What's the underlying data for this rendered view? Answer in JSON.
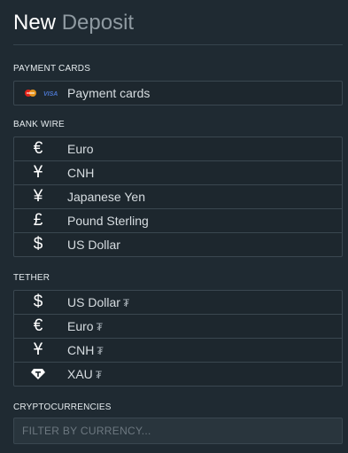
{
  "header": {
    "title_word1": "New",
    "title_word2": "Deposit"
  },
  "payment_cards": {
    "label": "PAYMENT CARDS",
    "items": [
      {
        "label": "Payment cards",
        "icon": "mastercard-visa-icon"
      }
    ]
  },
  "bank_wire": {
    "label": "BANK WIRE",
    "items": [
      {
        "icon_glyph": "€",
        "icon": "euro-icon",
        "label": "Euro"
      },
      {
        "icon_glyph": "Ұ",
        "icon": "cnh-yuan-icon",
        "label": "CNH"
      },
      {
        "icon_glyph": "¥",
        "icon": "yen-icon",
        "label": "Japanese Yen"
      },
      {
        "icon_glyph": "£",
        "icon": "pound-icon",
        "label": "Pound Sterling"
      },
      {
        "icon_glyph": "$",
        "icon": "dollar-icon",
        "label": "US Dollar"
      }
    ]
  },
  "tether": {
    "label": "TETHER",
    "items": [
      {
        "icon_glyph": "$",
        "icon": "dollar-icon",
        "label": "US Dollar",
        "suffix": "₮"
      },
      {
        "icon_glyph": "€",
        "icon": "euro-icon",
        "label": "Euro",
        "suffix": "₮"
      },
      {
        "icon_glyph": "Ұ",
        "icon": "cnh-yuan-icon",
        "label": "CNH",
        "suffix": "₮"
      },
      {
        "icon_glyph": "",
        "icon": "tether-gold-icon",
        "label": "XAU",
        "suffix": "₮"
      }
    ]
  },
  "crypto": {
    "label": "CRYPTOCURRENCIES",
    "filter_placeholder": "FILTER BY CURRENCY..."
  },
  "colors": {
    "background": "#1f2a32",
    "border": "#3a4750",
    "text": "#d7dde1",
    "title_accent": "#8f9aa1"
  }
}
